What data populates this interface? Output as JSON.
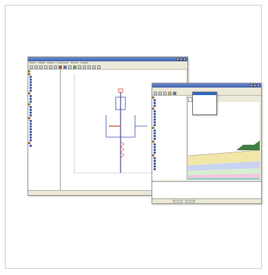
{
  "window1": {
    "title": "",
    "menus": [
      "File(F)",
      "Edit(E)",
      "View(V)",
      "Analysis(A)",
      "Tools(T)",
      "Help(H)"
    ],
    "tree": [
      "",
      "",
      "",
      "",
      "",
      "",
      "",
      "",
      "",
      "",
      "",
      "",
      "",
      "",
      "",
      "",
      "",
      "",
      "",
      "",
      "",
      "",
      "",
      "",
      "",
      "",
      "",
      ""
    ],
    "status": "",
    "axis_labels": [
      "",
      "",
      "",
      "",
      ""
    ]
  },
  "window2": {
    "title": "",
    "menus": [
      "",
      "",
      "",
      "",
      "",
      "",
      ""
    ],
    "dropdown": [
      "",
      "",
      "",
      "",
      "",
      "",
      "",
      ""
    ],
    "tabs": [
      "",
      "",
      ""
    ],
    "tree": [
      "",
      "",
      "",
      "",
      "",
      "",
      "",
      "",
      "",
      "",
      "",
      "",
      "",
      "",
      "",
      "",
      "",
      "",
      "",
      "",
      "",
      "",
      "",
      "",
      "",
      "",
      ""
    ],
    "messages": [
      "",
      "",
      "",
      "",
      ""
    ],
    "status": ""
  },
  "colors": {
    "accent": "#c0392b",
    "title_bar": "#3b5fb0",
    "chrome": "#ece9d8",
    "soil_layer_1": "#f2e7a8",
    "soil_layer_2": "#c9d3f2",
    "soil_layer_3": "#d7eed0",
    "soil_layer_4": "#f0c6dc",
    "soil_bottom": "#9ad0cf",
    "embankment": "#3f7f3f"
  }
}
